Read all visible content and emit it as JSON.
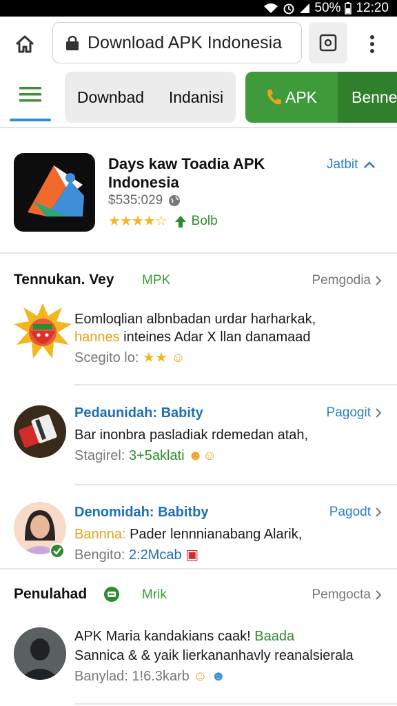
{
  "status_bar": {
    "battery": "50%",
    "time": "12:20"
  },
  "browser": {
    "url": "Download APK Indonesia"
  },
  "nav": {
    "search_word1": "Downbad",
    "search_word2": "Indanisi",
    "apk_label": "APK",
    "benne_label": "Benne"
  },
  "app": {
    "title": "Days kaw Toadia APK Indonesia",
    "size": "$535:029",
    "rating_label": "Bolb",
    "action_label": "Jatbit"
  },
  "section1": {
    "title": "Tennukan. Vey",
    "tag": "MPK",
    "link": "Pemgodia"
  },
  "reviews": [
    {
      "line1": "Eomloqlian albnbadan urdar harharkak,",
      "line2_highlight": "hannes",
      "line2": " inteines Adar X llan danamaad",
      "meta_label": "Scegito lo:",
      "meta_value": ""
    },
    {
      "author": "Pedaunidah: Babity",
      "link": "Pagogit",
      "line2": "Bar inonbra pasladiak rdemedan atah,",
      "meta_label": "Stagirel:",
      "meta_value": "3+5aklati"
    },
    {
      "author": "Denomidah: Babitby",
      "link": "Pagodt",
      "line2_highlight": "Bannna:",
      "line2": " Pader lennnianabang Alarik,",
      "meta_label": "Bengito:",
      "meta_value": "2:2Mcab"
    }
  ],
  "section2": {
    "title": "Penulahad",
    "tag": "Mrik",
    "link": "Pemgocta"
  },
  "review4": {
    "line1": "APK Maria kandakians caak! ",
    "line1_highlight": "Baada",
    "line2": "Sannica & & yaik lierkananhavly reanalsierala",
    "meta_label": "Banylad: 1!6.3karb"
  }
}
